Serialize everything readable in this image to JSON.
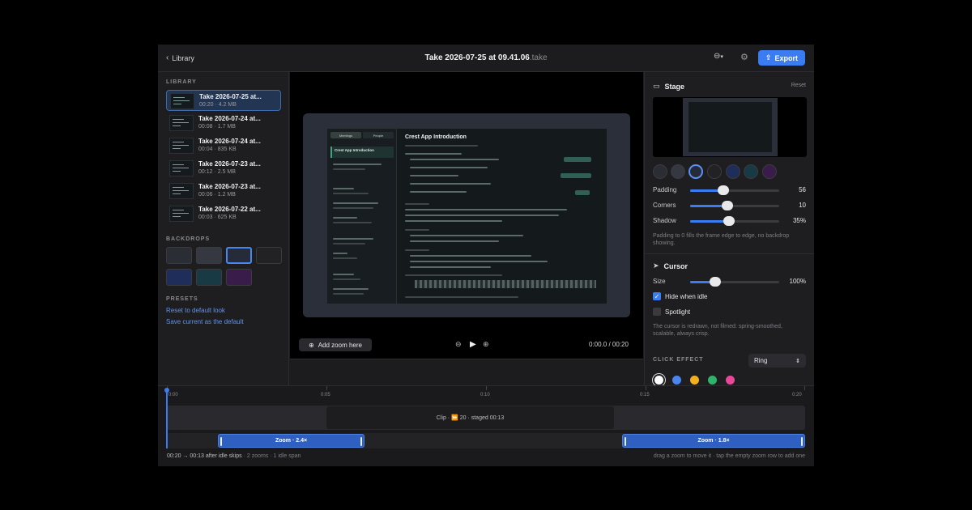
{
  "header": {
    "back_label": "Library",
    "title": "Take 2026-07-25 at 09.41.06",
    "title_ext": ".take",
    "export_label": "Export",
    "more_icon": "ellipsis-circle-icon",
    "gear_icon": "gear-icon"
  },
  "sidebar": {
    "library_heading": "LIBRARY",
    "takes": [
      {
        "name": "Take 2026-07-25 at...",
        "meta": "00:20 · 4.2 MB",
        "selected": true
      },
      {
        "name": "Take 2026-07-24 at...",
        "meta": "00:08 · 1.7 MB"
      },
      {
        "name": "Take 2026-07-24 at...",
        "meta": "00:04 · 835 KB"
      },
      {
        "name": "Take 2026-07-23 at...",
        "meta": "00:12 · 2.5 MB"
      },
      {
        "name": "Take 2026-07-23 at...",
        "meta": "00:06 · 1.2 MB"
      },
      {
        "name": "Take 2026-07-22 at...",
        "meta": "00:03 · 625 KB"
      }
    ],
    "backdrops_heading": "BACKDROPS",
    "presets_heading": "PRESETS",
    "preset_reset": "Reset to default look",
    "preset_save": "Save current as the default"
  },
  "preview": {
    "app_title": "Crest App Introduction",
    "tab_meetings": "Meetings",
    "tab_people": "People",
    "add_zoom_label": "Add zoom here",
    "timecode": "0:00.0 / 00:20"
  },
  "stage": {
    "heading": "Stage",
    "reset_label": "Reset",
    "padding_label": "Padding",
    "padding_value": "56",
    "padding_fraction": 0.37,
    "corners_label": "Corners",
    "corners_value": "10",
    "corners_fraction": 0.42,
    "shadow_label": "Shadow",
    "shadow_value": "35%",
    "shadow_fraction": 0.44,
    "hint": "Padding to 0 fills the frame edge to edge, no backdrop showing."
  },
  "cursor": {
    "heading": "Cursor",
    "size_label": "Size",
    "size_value": "100%",
    "size_fraction": 0.28,
    "hide_when_idle": "Hide when idle",
    "spotlight": "Spotlight",
    "hint": "The cursor is redrawn, not filmed: spring-smoothed, scalable, always crisp.",
    "click_effect_label": "CLICK EFFECT",
    "click_effect_value": "Ring",
    "click_colors": [
      "#ffffff",
      "#4a86f0",
      "#f0b020",
      "#2fb36a",
      "#e8489a"
    ]
  },
  "timeline": {
    "ticks": [
      "0:00",
      "0:05",
      "0:10",
      "0:15",
      "0:20"
    ],
    "clip_label": "Clip · ⏩ 20 · staged 00:13",
    "zoom1_label": "Zoom · 2.4×",
    "zoom2_label": "Zoom · 1.8×",
    "summary_main": "00:20 → 00:13 after idle skips",
    "summary_zooms": "· 2 zooms",
    "summary_idle": "· 1 idle span",
    "hint_right": "drag a zoom to move it · tap the empty zoom row to add one"
  }
}
